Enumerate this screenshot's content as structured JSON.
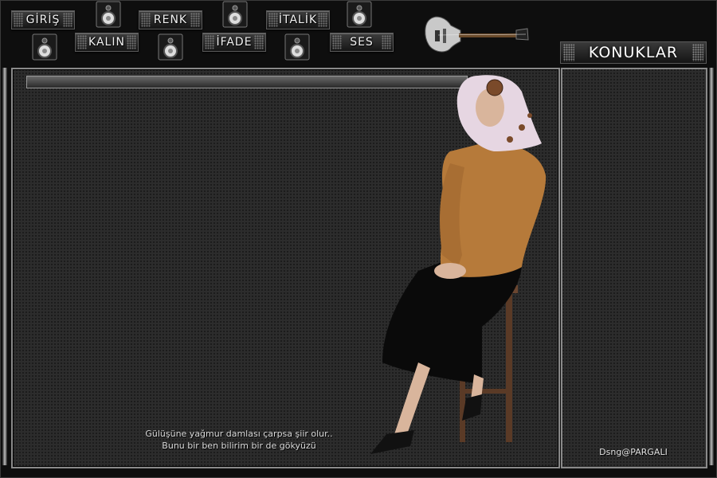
{
  "nav": {
    "buttons": [
      "GİRİŞ",
      "RENK",
      "İTALİK",
      "KALIN",
      "İFADE",
      "SES"
    ]
  },
  "sidebar": {
    "title": "KONUKLAR"
  },
  "poem": {
    "line1": "Gülüşüne yağmur damlası çarpsa şiir olur..",
    "line2": "Bunu bir ben bilirim bir de gökyüzü"
  },
  "signature": "Dsng@PARGALI",
  "icons": [
    "speaker-icon",
    "guitar-icon"
  ],
  "colors": {
    "background": "#0d0d0d",
    "panel": "#2c2c2c",
    "border": "#8a8a8a"
  }
}
